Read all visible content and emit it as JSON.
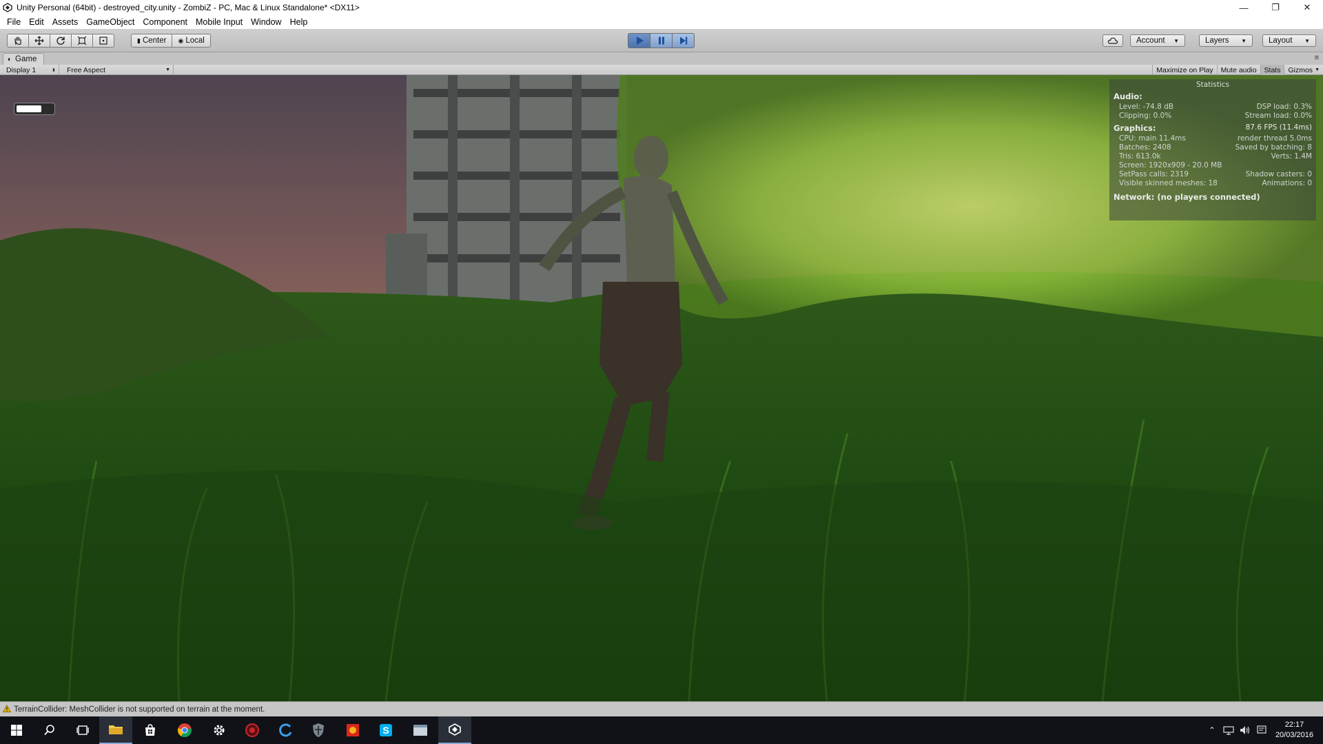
{
  "window": {
    "title": "Unity Personal (64bit) - destroyed_city.unity - ZombiZ - PC, Mac & Linux Standalone* <DX11>",
    "controls": [
      "—",
      "❐",
      "✕"
    ]
  },
  "menu": [
    "File",
    "Edit",
    "Assets",
    "GameObject",
    "Component",
    "Mobile Input",
    "Window",
    "Help"
  ],
  "toolbar": {
    "pivot_center": "Center",
    "pivot_local": "Local",
    "account": "Account",
    "layers": "Layers",
    "layout": "Layout"
  },
  "game_tab": {
    "label": "Game",
    "display": "Display 1",
    "aspect": "Free Aspect",
    "maximize": "Maximize on Play",
    "mute": "Mute audio",
    "stats": "Stats",
    "gizmos": "Gizmos"
  },
  "hud": {
    "bar_fraction": 0.7
  },
  "stats": {
    "title": "Statistics",
    "audio_head": "Audio:",
    "level": "Level: -74.8 dB",
    "dsp": "DSP load: 0.3%",
    "clipping": "Clipping: 0.0%",
    "stream": "Stream load: 0.0%",
    "graphics_head": "Graphics:",
    "fps": "87.6 FPS (11.4ms)",
    "cpu": "CPU: main 11.4ms",
    "render": "render thread 5.0ms",
    "batches": "Batches: 2408",
    "saved": "Saved by batching: 8",
    "tris": "Tris: 613.0k",
    "verts": "Verts: 1.4M",
    "screen": "Screen: 1920x909 - 20.0 MB",
    "setpass": "SetPass calls: 2319",
    "shadow": "Shadow casters: 0",
    "skinned": "Visible skinned meshes: 18",
    "animations": "Animations: 0",
    "network": "Network: (no players connected)"
  },
  "status": {
    "message": "TerrainCollider: MeshCollider is not supported on terrain at the moment."
  },
  "clock": {
    "time": "22:17",
    "date": "20/03/2016"
  }
}
